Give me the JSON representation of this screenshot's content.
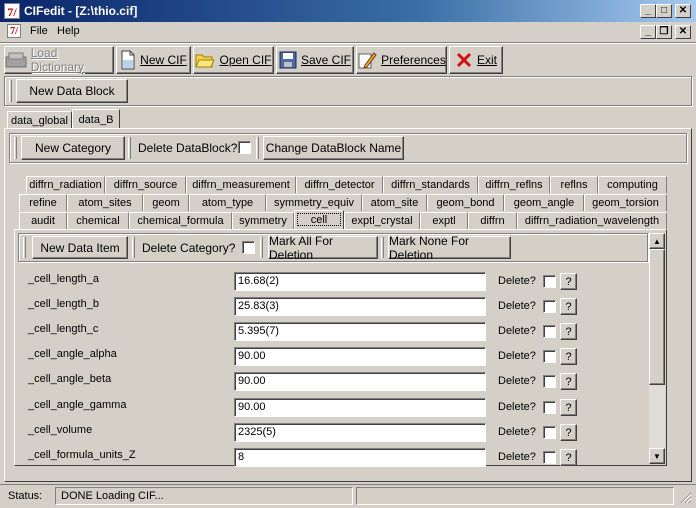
{
  "window": {
    "title": "CIFedit - [Z:\\thio.cif]",
    "app_icon": "7/",
    "controls": [
      "_",
      "□",
      "✕"
    ],
    "inner_controls": [
      "_",
      "❐",
      "✕"
    ]
  },
  "menu": {
    "items": [
      "File",
      "Help"
    ]
  },
  "toolbar": {
    "load_dictionary": "Load Dictionary",
    "new_cif": "New CIF",
    "open_cif": "Open CIF",
    "save_cif": "Save CIF",
    "preferences": "Preferences",
    "exit": "Exit"
  },
  "datablock_bar": {
    "new_data_block": "New Data Block"
  },
  "datablock_tabs": [
    "data_global",
    "data_B"
  ],
  "block_actions": {
    "new_category": "New Category",
    "delete_datablock": "Delete DataBlock?",
    "change_name": "Change DataBlock Name"
  },
  "category_tabs": {
    "row1": [
      "diffrn_radiation",
      "diffrn_source",
      "diffrn_measurement",
      "diffrn_detector",
      "diffrn_standards",
      "diffrn_reflns",
      "reflns",
      "computing"
    ],
    "row2": [
      "refine",
      "atom_sites",
      "geom",
      "atom_type",
      "symmetry_equiv",
      "atom_site",
      "geom_bond",
      "geom_angle",
      "geom_torsion"
    ],
    "row3": [
      "audit",
      "chemical",
      "chemical_formula",
      "symmetry",
      "cell",
      "exptl_crystal",
      "exptl",
      "diffrn",
      "diffrn_radiation_wavelength"
    ]
  },
  "category_actions": {
    "new_data_item": "New Data Item",
    "delete_category": "Delete Category?",
    "mark_all": "Mark All For Deletion",
    "mark_none": "Mark None For Deletion"
  },
  "items": [
    {
      "name": "_cell_length_a",
      "value": "16.68(2)"
    },
    {
      "name": "_cell_length_b",
      "value": "25.83(3)"
    },
    {
      "name": "_cell_length_c",
      "value": "5.395(7)"
    },
    {
      "name": "_cell_angle_alpha",
      "value": "90.00"
    },
    {
      "name": "_cell_angle_beta",
      "value": "90.00"
    },
    {
      "name": "_cell_angle_gamma",
      "value": "90.00"
    },
    {
      "name": "_cell_volume",
      "value": "2325(5)"
    },
    {
      "name": "_cell_formula_units_Z",
      "value": "8"
    }
  ],
  "item_labels": {
    "delete": "Delete?",
    "help": "?"
  },
  "status": {
    "label": "Status:",
    "text": "DONE Loading CIF..."
  },
  "colors": {
    "titlebar_start": "#0a246a",
    "titlebar_end": "#a6caf0",
    "face": "#d4d0c8"
  }
}
